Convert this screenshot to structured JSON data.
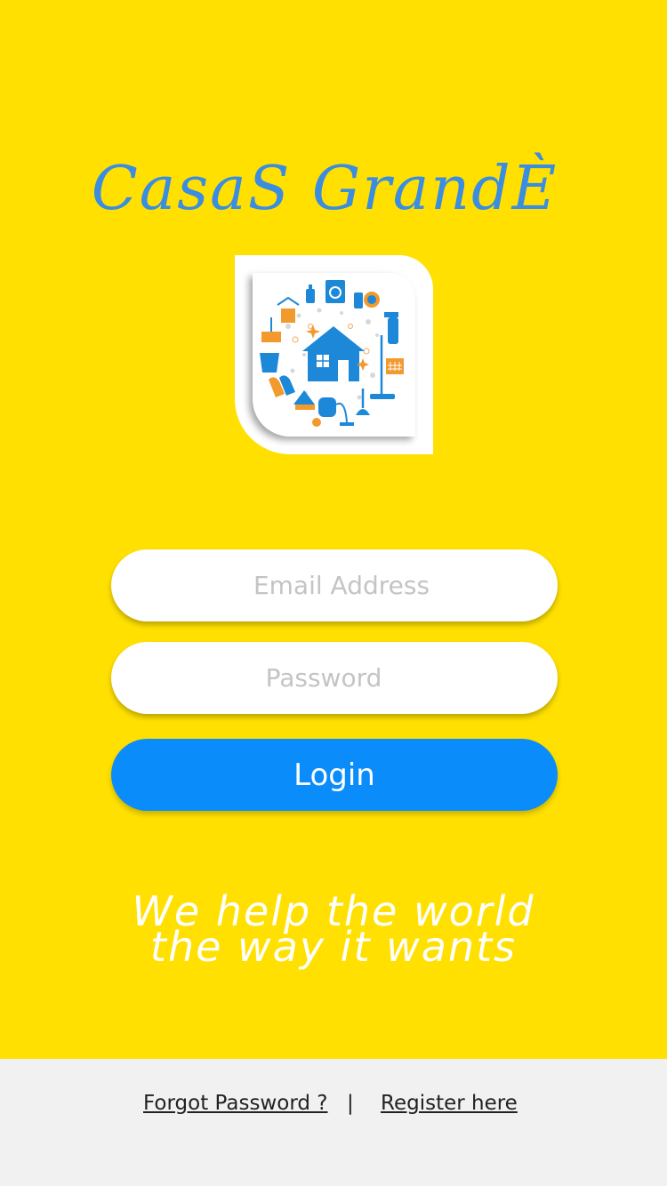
{
  "brand": {
    "title": "CasaS GrandÈ",
    "title_color": "#3a8de0",
    "logo_icon": "house-cleaning-icon"
  },
  "form": {
    "email_placeholder": "Email Address",
    "password_placeholder": "Password",
    "login_label": "Login"
  },
  "tagline": {
    "line1": "We help the world",
    "line2": "the way it wants"
  },
  "footer": {
    "forgot_label": "Forgot Password ?",
    "separator": "|",
    "register_label": "Register here"
  },
  "colors": {
    "background": "#ffe000",
    "primary_button": "#0a8cfa",
    "footer_background": "#f1f1f1"
  }
}
